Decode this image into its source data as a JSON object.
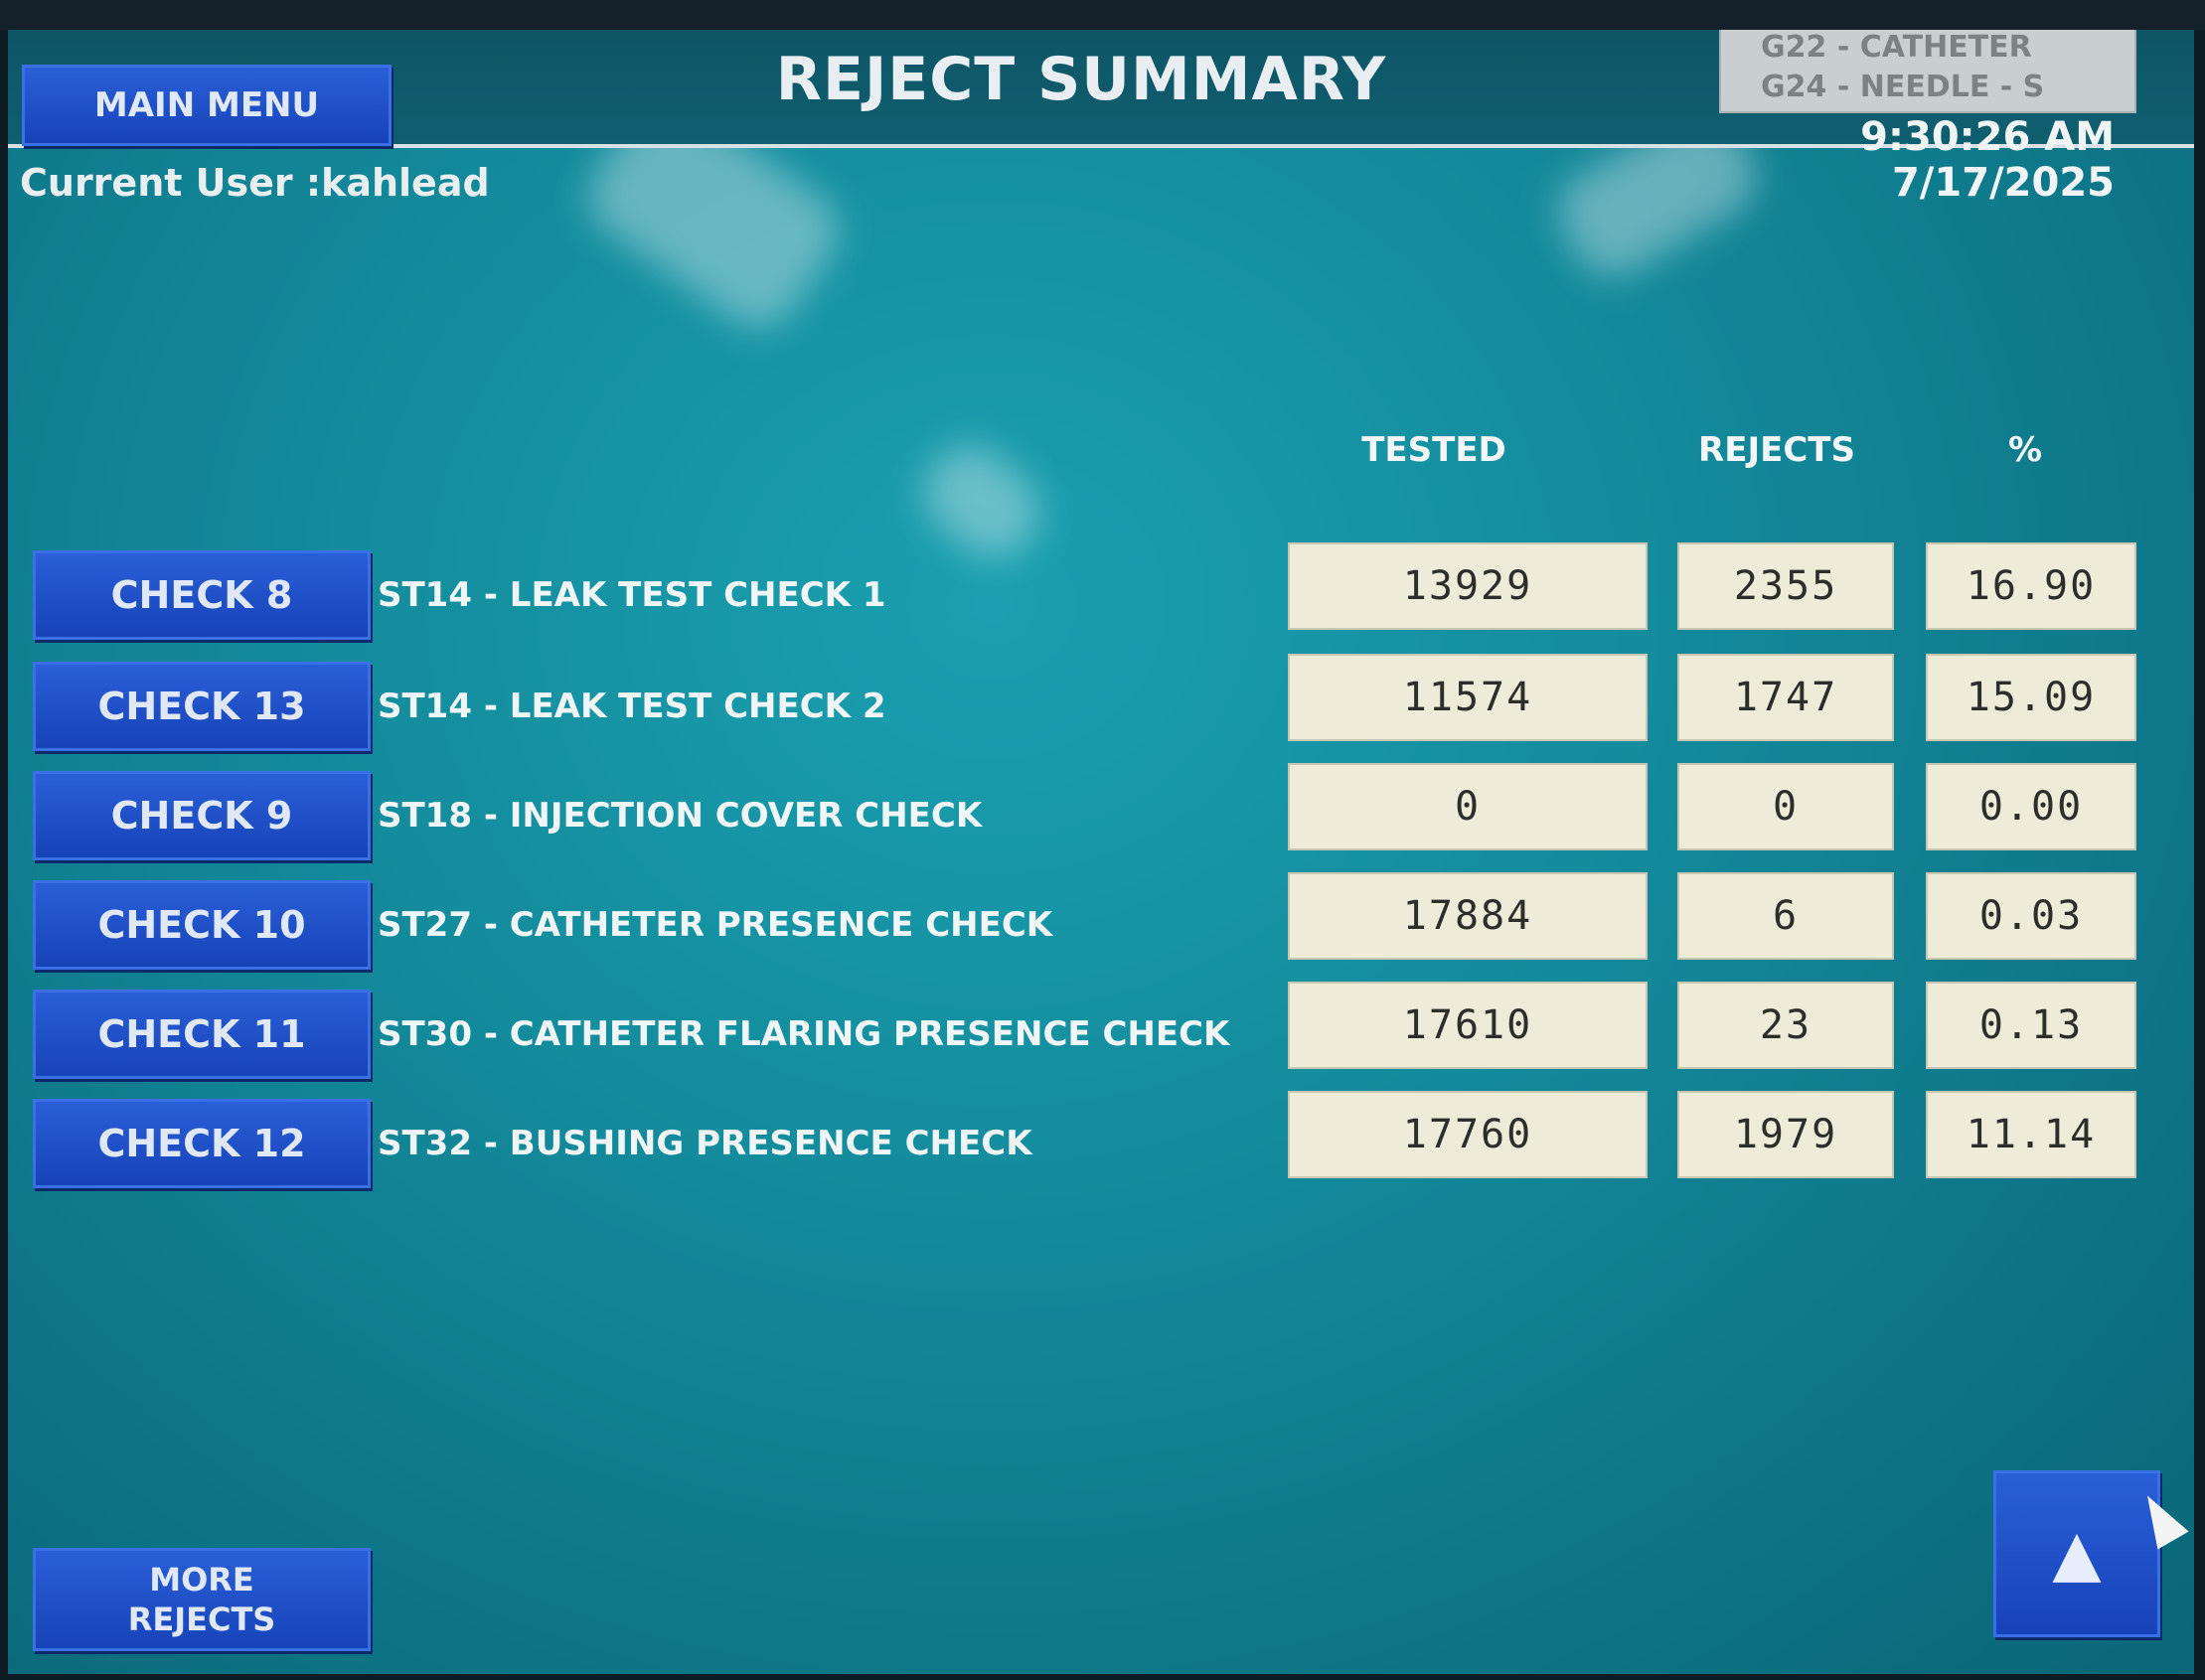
{
  "header": {
    "title": "REJECT SUMMARY",
    "main_menu_label": "MAIN MENU",
    "product_line1": "G22 - CATHETER",
    "product_line2": "G24 - NEEDLE - S",
    "datetime": "9:30:26 AM 7/17/2025",
    "current_user": "Current User :kahlead"
  },
  "columns": {
    "tested": "TESTED",
    "rejects": "REJECTS",
    "percent": "%"
  },
  "rows": [
    {
      "check": "CHECK 8",
      "desc": "ST14 - LEAK TEST CHECK 1",
      "tested": "13929",
      "rejects": "2355",
      "percent": "16.90"
    },
    {
      "check": "CHECK 13",
      "desc": "ST14 - LEAK TEST CHECK 2",
      "tested": "11574",
      "rejects": "1747",
      "percent": "15.09"
    },
    {
      "check": "CHECK 9",
      "desc": "ST18 - INJECTION COVER CHECK",
      "tested": "0",
      "rejects": "0",
      "percent": "0.00"
    },
    {
      "check": "CHECK 10",
      "desc": "ST27 - CATHETER PRESENCE CHECK",
      "tested": "17884",
      "rejects": "6",
      "percent": "0.03"
    },
    {
      "check": "CHECK 11",
      "desc": "ST30 - CATHETER FLARING PRESENCE CHECK",
      "tested": "17610",
      "rejects": "23",
      "percent": "0.13"
    },
    {
      "check": "CHECK 12",
      "desc": "ST32 - BUSHING PRESENCE CHECK",
      "tested": "17760",
      "rejects": "1979",
      "percent": "11.14"
    }
  ],
  "footer": {
    "more_rejects_line1": "MORE",
    "more_rejects_line2": "REJECTS",
    "up_icon": "up-arrow-icon"
  },
  "colors": {
    "screen_bg": "#138b9c",
    "button_blue": "#1e4fc8",
    "value_box": "#eeebd8"
  }
}
